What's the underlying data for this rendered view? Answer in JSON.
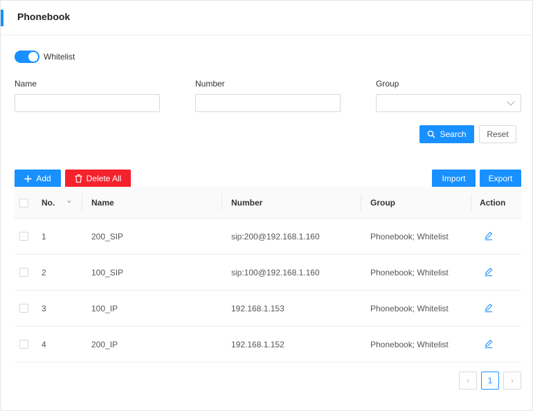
{
  "header": {
    "title": "Phonebook"
  },
  "whitelist": {
    "label": "Whitelist",
    "enabled": true
  },
  "filters": {
    "name_label": "Name",
    "number_label": "Number",
    "group_label": "Group",
    "name_value": "",
    "number_value": "",
    "group_value": ""
  },
  "buttons": {
    "search": "Search",
    "reset": "Reset",
    "add": "Add",
    "delete_all": "Delete All",
    "import": "Import",
    "export": "Export"
  },
  "table": {
    "columns": [
      "No.",
      "Name",
      "Number",
      "Group",
      "Action"
    ],
    "rows": [
      {
        "no": "1",
        "name": "200_SIP",
        "number": "sip:200@192.168.1.160",
        "group": "Phonebook; Whitelist"
      },
      {
        "no": "2",
        "name": "100_SIP",
        "number": "sip:100@192.168.1.160",
        "group": "Phonebook; Whitelist"
      },
      {
        "no": "3",
        "name": "100_IP",
        "number": "192.168.1.153",
        "group": "Phonebook; Whitelist"
      },
      {
        "no": "4",
        "name": "200_IP",
        "number": "192.168.1.152",
        "group": "Phonebook; Whitelist"
      }
    ]
  },
  "pagination": {
    "current": "1"
  },
  "colors": {
    "primary": "#1890ff",
    "danger": "#f5222d"
  }
}
